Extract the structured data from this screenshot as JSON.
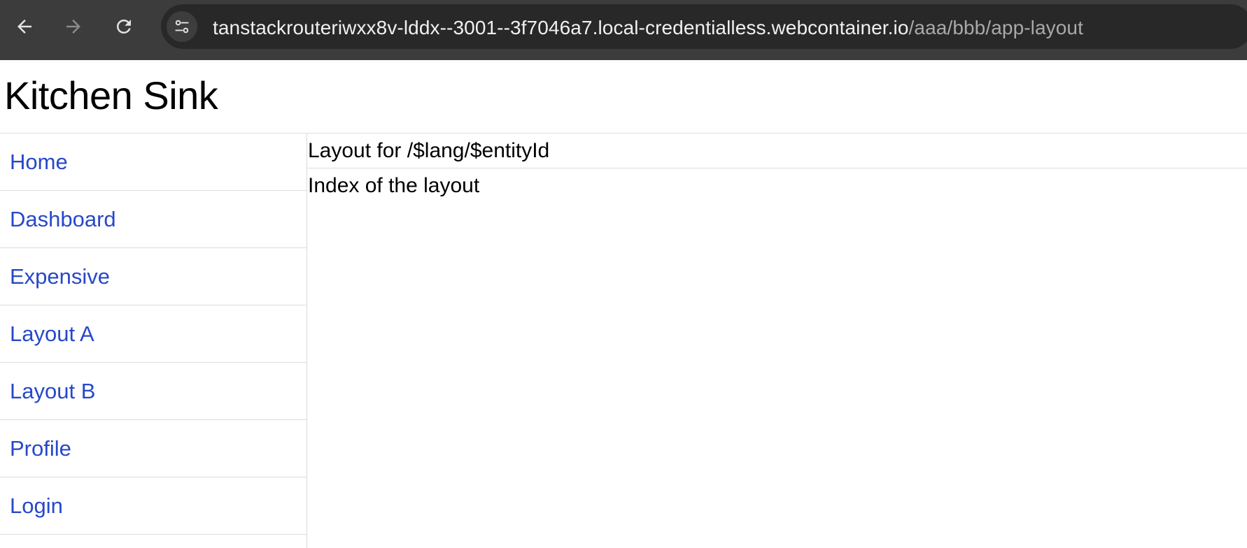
{
  "browser": {
    "url_host": "tanstackrouteriwxx8v-lddx--3001--3f7046a7.local-credentialless.webcontainer.io",
    "url_path": "/aaa/bbb/app-layout",
    "icons": {
      "back": "back-arrow-icon",
      "forward": "forward-arrow-icon",
      "reload": "reload-icon",
      "site_info": "tune-icon"
    }
  },
  "app": {
    "title": "Kitchen Sink"
  },
  "sidebar": {
    "items": [
      {
        "label": "Home"
      },
      {
        "label": "Dashboard"
      },
      {
        "label": "Expensive"
      },
      {
        "label": "Layout A"
      },
      {
        "label": "Layout B"
      },
      {
        "label": "Profile"
      },
      {
        "label": "Login"
      }
    ]
  },
  "main": {
    "layout_header": "Layout for /$lang/$entityId",
    "layout_index": "Index of the layout"
  },
  "colors": {
    "link": "#2748c9",
    "browser_bar": "#3c3c3c",
    "omnibox": "#282828",
    "divider": "#dcdcdc"
  }
}
